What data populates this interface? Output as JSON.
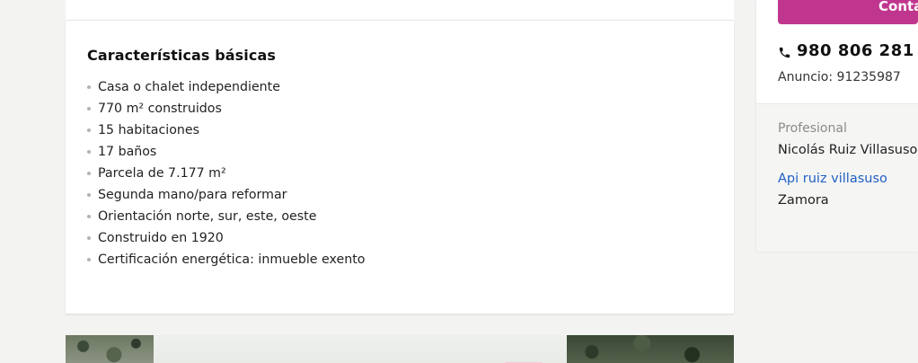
{
  "features": {
    "title": "Características básicas",
    "items": [
      "Casa o chalet independiente",
      "770 m² construidos",
      "15 habitaciones",
      "17 baños",
      "Parcela de 7.177 m²",
      "Segunda mano/para reformar",
      "Orientación norte, sur, este, oeste",
      "Construido en 1920",
      "Certificación energética: inmueble exento"
    ]
  },
  "contact": {
    "button_label": "Contactar",
    "phone": "980 806 281",
    "phone_icon": "phone-icon",
    "ad_label": "Anuncio:",
    "ad_number": "91235987"
  },
  "advertiser": {
    "kind": "Profesional",
    "name": "Nicolás Ruiz Villasuso",
    "link_label": "Api ruiz villasuso",
    "city": "Zamora"
  },
  "colors": {
    "accent": "#c0368e",
    "link": "#2060c4",
    "page_bg": "#f3f3f1"
  }
}
